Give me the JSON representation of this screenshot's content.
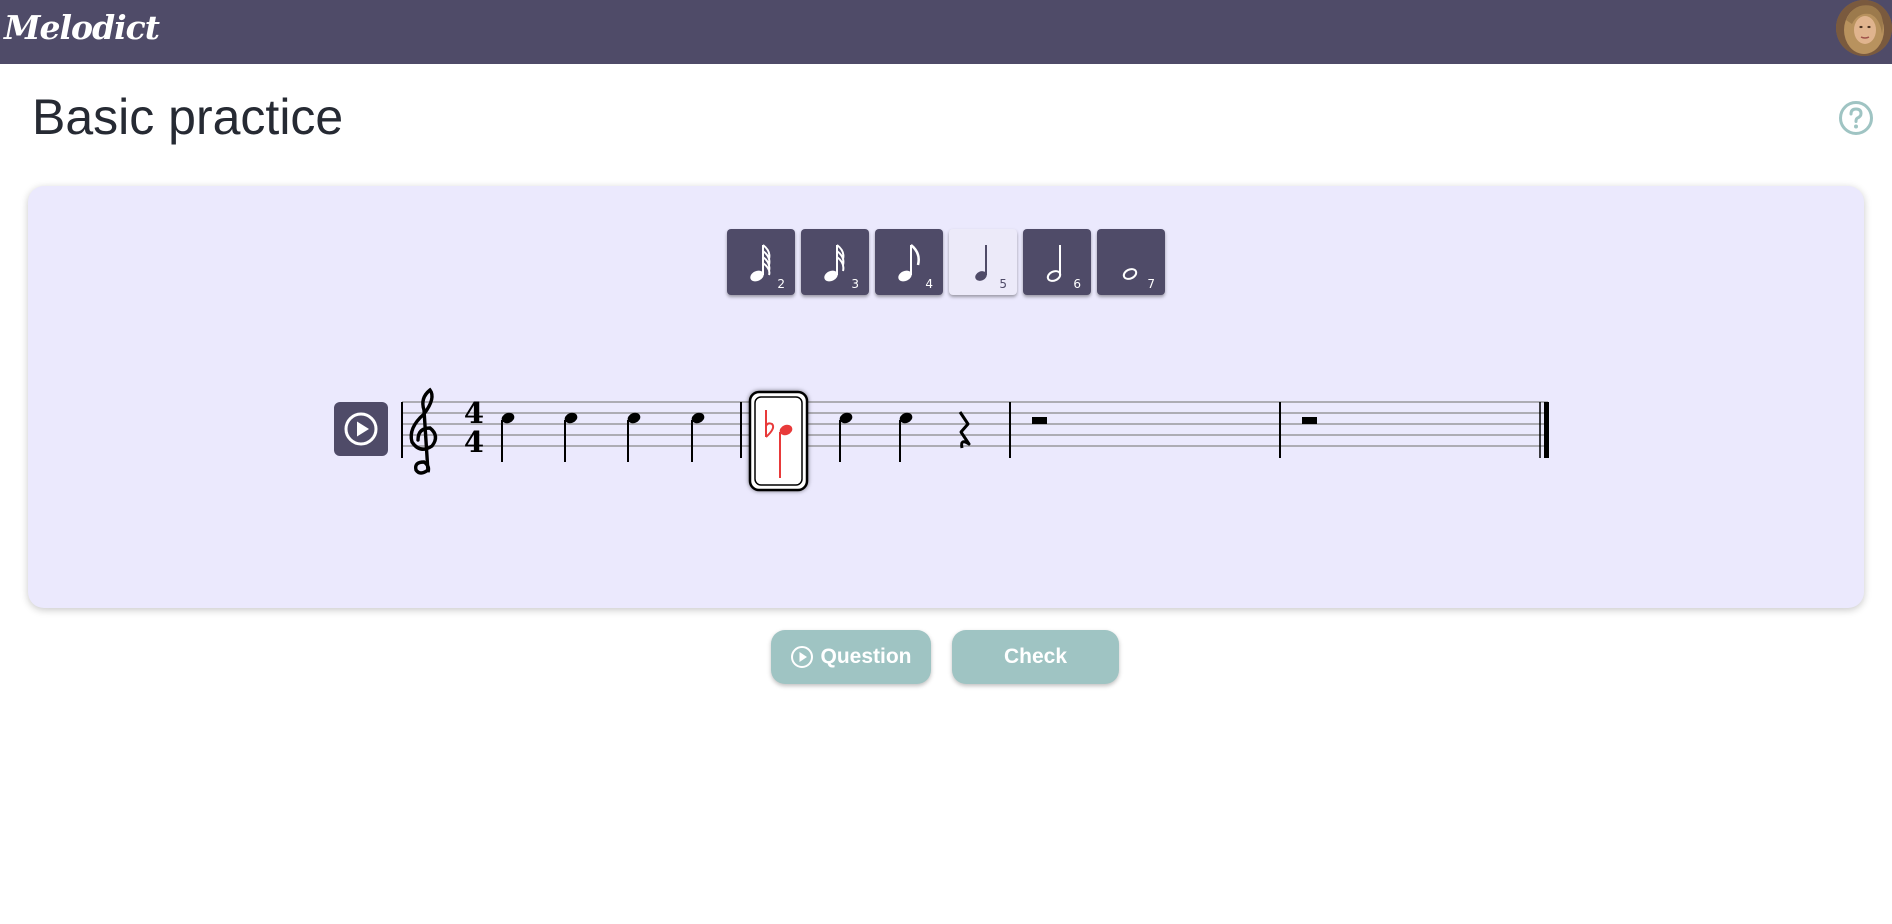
{
  "app": {
    "name": "Melodict"
  },
  "page": {
    "title": "Basic practice"
  },
  "icons": {
    "help": "question-circle-icon",
    "play": "play-circle-icon",
    "avatar": "user-avatar"
  },
  "colors": {
    "topbar": "#4f4b68",
    "panel": "#ebe9fd",
    "action": "#9fc4c3",
    "selected_note": "#e83a3a"
  },
  "durations": [
    {
      "name": "64th-note",
      "key": "2",
      "selected": false
    },
    {
      "name": "32nd-note",
      "key": "3",
      "selected": false
    },
    {
      "name": "eighth-note",
      "key": "4",
      "selected": false
    },
    {
      "name": "quarter-note",
      "key": "5",
      "selected": true
    },
    {
      "name": "half-note",
      "key": "6",
      "selected": false
    },
    {
      "name": "whole-note",
      "key": "7",
      "selected": false
    }
  ],
  "score": {
    "clef": "treble",
    "time_signature": {
      "top": "4",
      "bottom": "4"
    },
    "measures": [
      {
        "items": [
          "quarter",
          "quarter",
          "quarter",
          "quarter"
        ]
      },
      {
        "items": [
          "half-flat-selected",
          "quarter",
          "quarter",
          "quarter-rest"
        ]
      },
      {
        "items": [
          "whole-rest"
        ]
      },
      {
        "items": [
          "whole-rest"
        ]
      }
    ]
  },
  "actions": {
    "question_label": "Question",
    "check_label": "Check"
  }
}
